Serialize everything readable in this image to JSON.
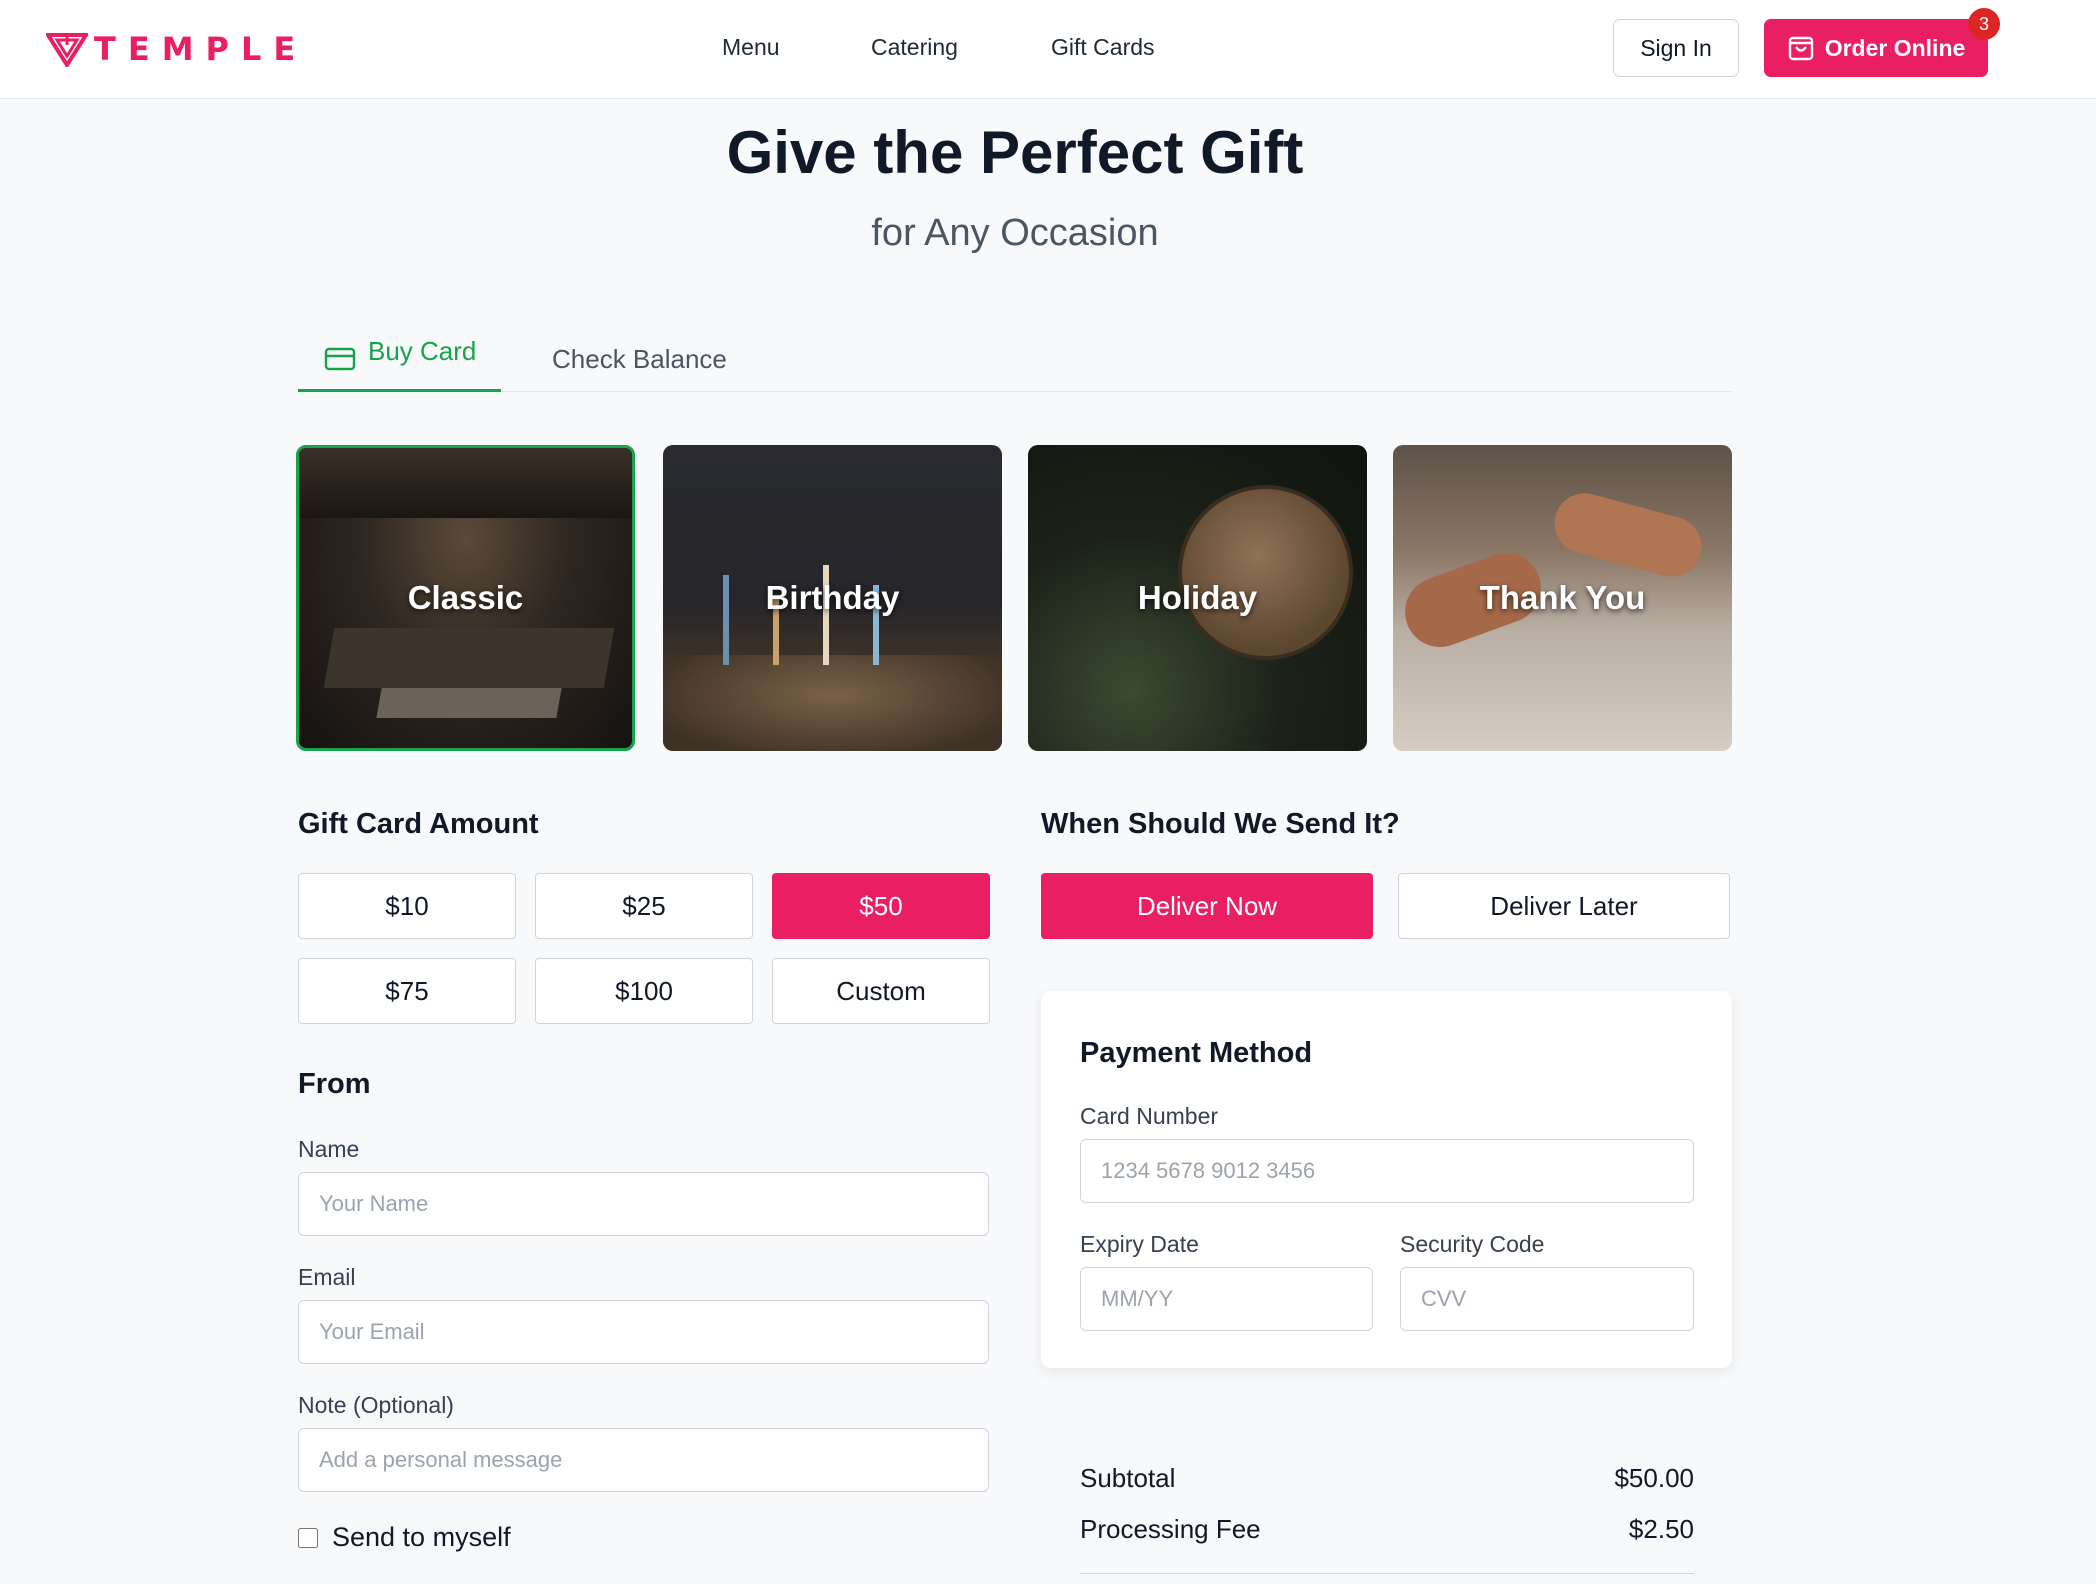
{
  "header": {
    "logo_text": "TEMPLE",
    "nav": [
      "Menu",
      "Catering",
      "Gift Cards"
    ],
    "sign_in": "Sign In",
    "order_online": "Order Online",
    "cart_count": "3"
  },
  "hero": {
    "title": "Give the Perfect Gift",
    "subtitle": "for Any Occasion"
  },
  "tabs": {
    "buy": "Buy Card",
    "check": "Check Balance"
  },
  "designs": [
    {
      "label": "Classic",
      "selected": true
    },
    {
      "label": "Birthday",
      "selected": false
    },
    {
      "label": "Holiday",
      "selected": false
    },
    {
      "label": "Thank You",
      "selected": false
    }
  ],
  "amount": {
    "title": "Gift Card Amount",
    "options": [
      "$10",
      "$25",
      "$50",
      "$75",
      "$100",
      "Custom"
    ],
    "selected": "$50"
  },
  "delivery": {
    "title": "When Should We Send It?",
    "now": "Deliver Now",
    "later": "Deliver Later"
  },
  "from": {
    "title": "From",
    "name_label": "Name",
    "name_placeholder": "Your Name",
    "email_label": "Email",
    "email_placeholder": "Your Email",
    "note_label": "Note (Optional)",
    "note_placeholder": "Add a personal message",
    "send_myself": "Send to myself"
  },
  "payment": {
    "title": "Payment Method",
    "card_label": "Card Number",
    "card_placeholder": "1234 5678 9012 3456",
    "expiry_label": "Expiry Date",
    "expiry_placeholder": "MM/YY",
    "cvv_label": "Security Code",
    "cvv_placeholder": "CVV"
  },
  "summary": {
    "subtotal_label": "Subtotal",
    "subtotal_value": "$50.00",
    "fee_label": "Processing Fee",
    "fee_value": "$2.50"
  },
  "colors": {
    "brand": "#e91e63",
    "accent_green": "#16a34a",
    "badge": "#dc2626"
  },
  "icons": [
    "logo-icon",
    "shopping-bag-icon",
    "credit-card-icon"
  ]
}
